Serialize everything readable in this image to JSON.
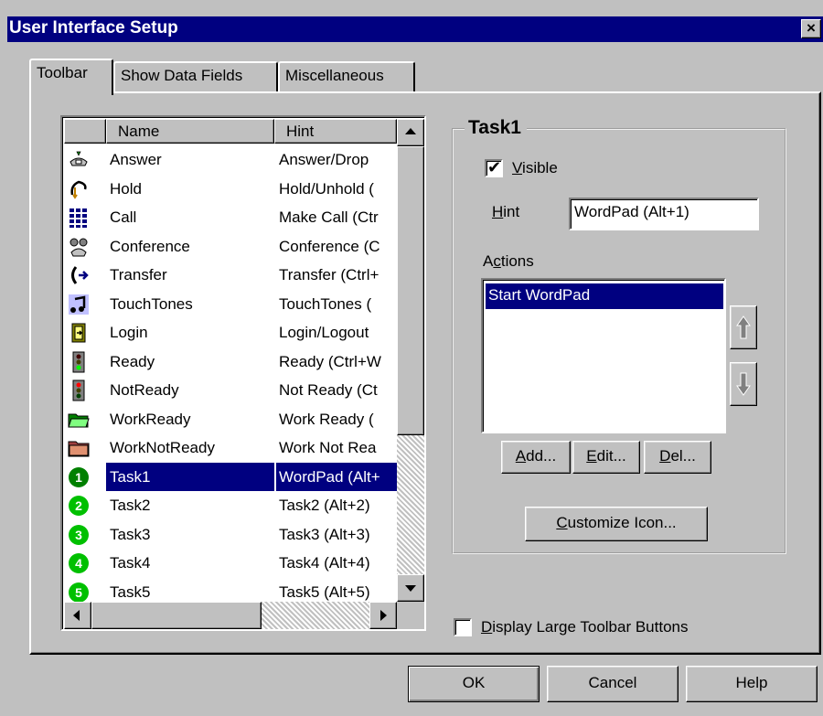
{
  "window": {
    "title": "User Interface Setup",
    "close_glyph": "×"
  },
  "tabs": [
    {
      "label": "Toolbar",
      "active": true
    },
    {
      "label": "Show Data Fields",
      "active": false
    },
    {
      "label": "Miscellaneous",
      "active": false
    }
  ],
  "list": {
    "columns": [
      "",
      "Name",
      "Hint"
    ],
    "rows": [
      {
        "icon": "answer-phone-icon",
        "name": "Answer",
        "hint": "Answer/Drop"
      },
      {
        "icon": "hold-phone-icon",
        "name": "Hold",
        "hint": "Hold/Unhold ("
      },
      {
        "icon": "keypad-call-icon",
        "name": "Call",
        "hint": "Make Call (Ctr"
      },
      {
        "icon": "conference-icon",
        "name": "Conference",
        "hint": "Conference (C"
      },
      {
        "icon": "transfer-icon",
        "name": "Transfer",
        "hint": "Transfer (Ctrl+"
      },
      {
        "icon": "touchtones-note-icon",
        "name": "TouchTones",
        "hint": "TouchTones ("
      },
      {
        "icon": "login-door-icon",
        "name": "Login",
        "hint": "Login/Logout"
      },
      {
        "icon": "traffic-light-green-icon",
        "name": "Ready",
        "hint": "Ready (Ctrl+W"
      },
      {
        "icon": "traffic-light-red-icon",
        "name": "NotReady",
        "hint": "Not Ready (Ct"
      },
      {
        "icon": "open-folder-green-icon",
        "name": "WorkReady",
        "hint": "Work Ready ("
      },
      {
        "icon": "folder-red-icon",
        "name": "WorkNotReady",
        "hint": "Work Not Rea"
      },
      {
        "icon": "task-1-icon",
        "name": "Task1",
        "hint": "WordPad (Alt+",
        "selected": true
      },
      {
        "icon": "task-2-icon",
        "name": "Task2",
        "hint": "Task2 (Alt+2)"
      },
      {
        "icon": "task-3-icon",
        "name": "Task3",
        "hint": "Task3 (Alt+3)"
      },
      {
        "icon": "task-4-icon",
        "name": "Task4",
        "hint": "Task4 (Alt+4)"
      },
      {
        "icon": "task-5-icon",
        "name": "Task5",
        "hint": "Task5 (Alt+5)"
      }
    ]
  },
  "details": {
    "group_title": "Task1",
    "visible_checked": true,
    "visible_prefix": "",
    "visible_mnemonic": "V",
    "visible_rest": "isible",
    "hint_mnemonic": "H",
    "hint_rest": "int",
    "hint_value": "WordPad (Alt+1)",
    "actions_prefix": "A",
    "actions_mnemonic": "c",
    "actions_rest": "tions",
    "actions": [
      "Start WordPad"
    ],
    "add_mnemonic": "A",
    "add_rest": "dd...",
    "edit_mnemonic": "E",
    "edit_rest": "dit...",
    "del_mnemonic": "D",
    "del_rest": "el...",
    "customize_mnemonic": "C",
    "customize_rest": "ustomize Icon..."
  },
  "large_buttons": {
    "checked": false,
    "mnemonic": "D",
    "rest": "isplay Large Toolbar Buttons"
  },
  "footer": {
    "ok": "OK",
    "cancel": "Cancel",
    "help": "Help"
  }
}
